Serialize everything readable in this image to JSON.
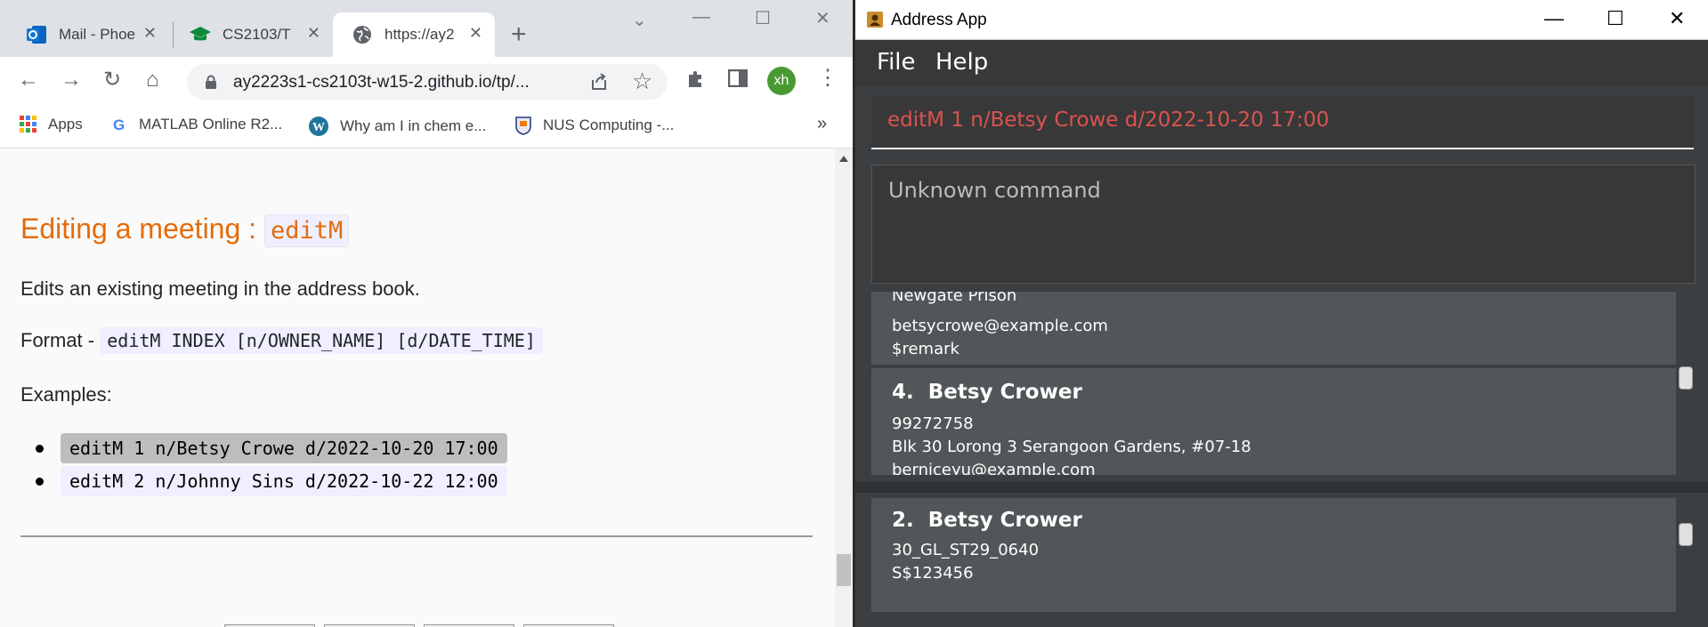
{
  "browser": {
    "tabs": [
      {
        "label": "Mail - Phoe",
        "icon": "outlook-icon"
      },
      {
        "label": "CS2103/T",
        "icon": "graduation-cap-icon"
      },
      {
        "label": "https://ay2",
        "icon": "globe-icon"
      }
    ],
    "url": "ay2223s1-cs2103t-w15-2.github.io/tp/...",
    "avatar": "xh",
    "bookmarks": [
      {
        "label": "Apps",
        "icon": "apps-grid-icon"
      },
      {
        "label": "MATLAB Online R2...",
        "icon": "google-icon"
      },
      {
        "label": "Why am I in chem e...",
        "icon": "wordpress-icon"
      },
      {
        "label": "NUS Computing -...",
        "icon": "nus-crest-icon"
      }
    ],
    "overflow": "»"
  },
  "doc": {
    "heading_text": "Editing a meeting : ",
    "heading_code": "editM",
    "description": "Edits an existing meeting in the address book.",
    "format_label": "Format - ",
    "format_code": "editM INDEX [n/OWNER_NAME] [d/DATE_TIME]",
    "examples_label": "Examples:",
    "examples": [
      "editM 1 n/Betsy Crowe d/2022-10-20 17:00",
      "editM 2 n/Johnny Sins d/2022-10-22 12:00"
    ]
  },
  "app": {
    "title": "Address App",
    "menus": [
      "File",
      "Help"
    ],
    "command": "editM 1 n/Betsy Crowe d/2022-10-20 17:00",
    "result": "Unknown command",
    "persons_partial": [
      "Newgate Prison",
      "betsycrowe@example.com",
      "$remark"
    ],
    "person_card": {
      "index": "4.",
      "name": "Betsy Crower",
      "phone": "99272758",
      "address": "Blk 30 Lorong 3 Serangoon Gardens, #07-18",
      "email": "berniceyu@example.com"
    },
    "meeting_card": {
      "index": "2.",
      "name": "Betsy Crower",
      "line1": "30_GL_ST29_0640",
      "line2": "S$123456"
    }
  }
}
